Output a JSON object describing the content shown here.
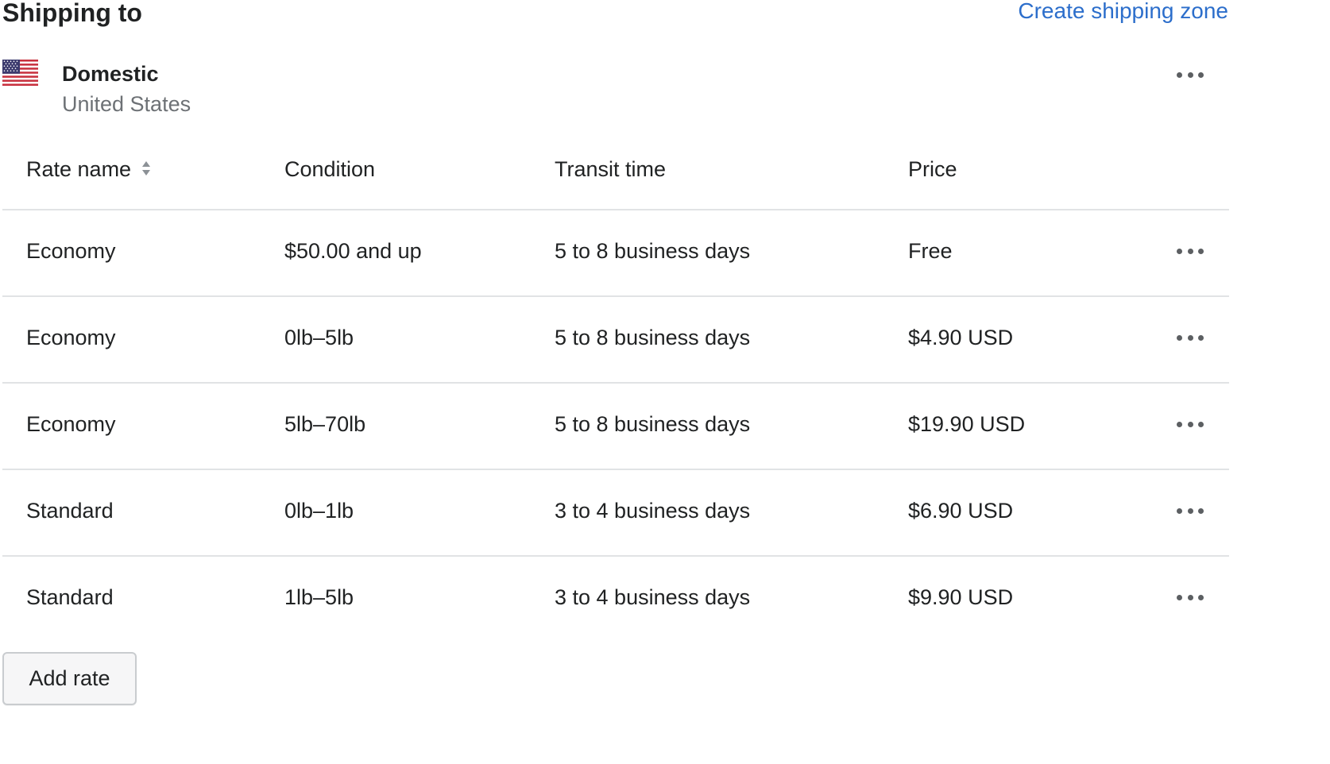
{
  "header": {
    "title": "Shipping to",
    "create_link": "Create shipping zone"
  },
  "zone": {
    "name": "Domestic",
    "country": "United States",
    "flag_icon": "us-flag-icon"
  },
  "table": {
    "columns": {
      "rate_name": "Rate name",
      "condition": "Condition",
      "transit_time": "Transit time",
      "price": "Price"
    },
    "rows": [
      {
        "rate_name": "Economy",
        "condition": "$50.00 and up",
        "transit_time": "5 to 8 business days",
        "price": "Free"
      },
      {
        "rate_name": "Economy",
        "condition": "0lb–5lb",
        "transit_time": "5 to 8 business days",
        "price": "$4.90 USD"
      },
      {
        "rate_name": "Economy",
        "condition": "5lb–70lb",
        "transit_time": "5 to 8 business days",
        "price": "$19.90 USD"
      },
      {
        "rate_name": "Standard",
        "condition": "0lb–1lb",
        "transit_time": "3 to 4 business days",
        "price": "$6.90 USD"
      },
      {
        "rate_name": "Standard",
        "condition": "1lb–5lb",
        "transit_time": "3 to 4 business days",
        "price": "$9.90 USD"
      }
    ]
  },
  "actions": {
    "add_rate": "Add rate"
  },
  "colors": {
    "link": "#2c6ecb",
    "text": "#202223",
    "subdued": "#6d7175",
    "divider": "#e1e3e5"
  }
}
